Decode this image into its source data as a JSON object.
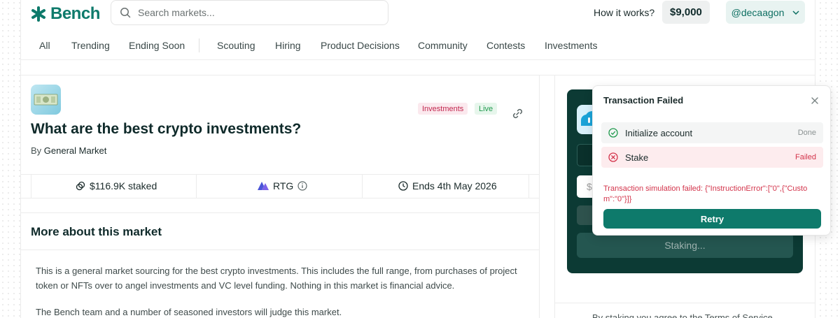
{
  "header": {
    "logo_text": "Bench",
    "search_placeholder": "Search markets...",
    "how_it_works": "How it works?",
    "balance": "$9,000",
    "username": "@decaagon"
  },
  "nav": {
    "items": [
      "All",
      "Trending",
      "Ending Soon",
      "Scouting",
      "Hiring",
      "Product Decisions",
      "Community",
      "Contests",
      "Investments"
    ]
  },
  "market": {
    "tags": [
      "Investments",
      "Live"
    ],
    "title": "What are the best crypto investments?",
    "by_prefix": "By",
    "author": "General Market",
    "staked": "$116.9K staked",
    "token": "RTG",
    "ends": "Ends 4th May 2026"
  },
  "about": {
    "title": "More about this market",
    "description": "This is a general market sourcing for the best crypto investments. This includes the full range, from purchases of project token or NFTs over to angel investments and VC level funding. Nothing in this market is financial advice.",
    "description_2": "The Bench team and a number of seasoned investors will judge this market."
  },
  "stake_panel": {
    "input_prefix": "$",
    "button_label": "Staking...",
    "terms_text": "By staking you agree to the Terms of Service"
  },
  "modal": {
    "title": "Transaction Failed",
    "steps": [
      {
        "label": "Initialize account",
        "status": "Done"
      },
      {
        "label": "Stake",
        "status": "Failed"
      }
    ],
    "error": "Transaction simulation failed: {\"InstructionError\":[\"0\",{\"Custom\":\"0\"}]}",
    "retry_label": "Retry"
  },
  "colors": {
    "brand": "#0e7a6b",
    "panel_bg": "#0c3a34",
    "error": "#d3344b",
    "success": "#1f9a4d"
  }
}
